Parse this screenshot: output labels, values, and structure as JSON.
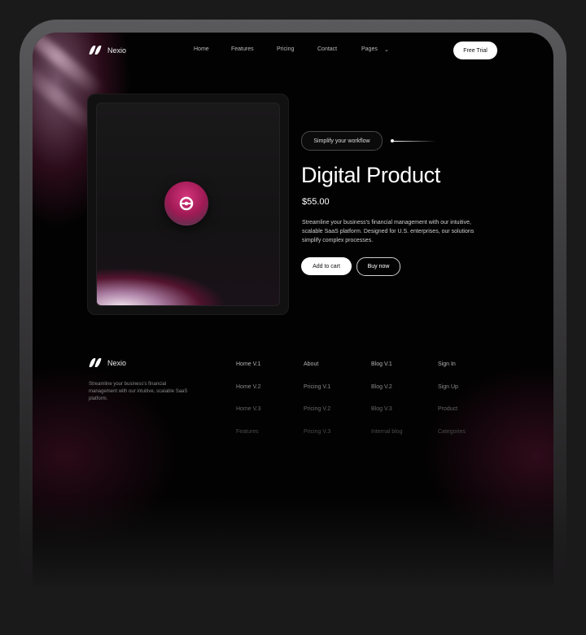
{
  "brand": {
    "name": "Nexio"
  },
  "nav": {
    "items": [
      "Home",
      "Features",
      "Pricing",
      "Contact",
      "Pages"
    ],
    "pages_chevron": "⌄",
    "cta": "Free Trial"
  },
  "hero": {
    "pill": "Simplify your workflow",
    "title": "Digital Product",
    "price": "$55.00",
    "description": "Streamline your business's financial management with our intuitive, scalable SaaS platform. Designed for U.S. enterprises, our solutions simplify complex processes.",
    "add_to_cart": "Add to cart",
    "buy_now": "Buy now"
  },
  "footer": {
    "brand": "Nexio",
    "description": "Streamline your business's financial management with our intuitive, scalable SaaS platform.",
    "columns": [
      [
        "Home V.1",
        "Home V.2",
        "Home V.3",
        "Features"
      ],
      [
        "About",
        "Pricing V.1",
        "Pricing V.2",
        "Pricing V.3"
      ],
      [
        "Blog V.1",
        "Blog V.2",
        "Blog V.3",
        "Internal blog"
      ],
      [
        "Sign In",
        "Sign Up",
        "Product",
        "Categories"
      ]
    ]
  },
  "colors": {
    "accent": "#c3276b",
    "background": "#020202",
    "page": "#1b1a1b"
  }
}
